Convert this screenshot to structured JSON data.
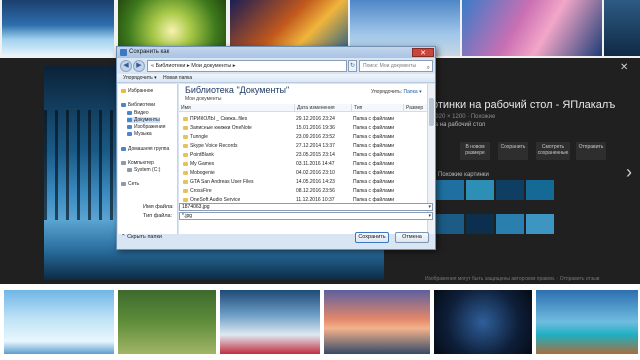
{
  "dialog": {
    "title": "Сохранить как",
    "close_label": "✕",
    "address": "« Библиотеки ▸ Мои документы ▸",
    "search_placeholder": "Поиск: Мои документы",
    "toolbar": {
      "organize": "Упорядочить ▾",
      "new_folder": "Новая папка"
    },
    "nav_pane": {
      "favorites": "Избранное",
      "downloads": "Видео",
      "documents": "Документы",
      "images": "Изображения",
      "music": "Музыка",
      "libraries_label": "Библиотеки",
      "homegroup": "Домашняя группа",
      "computer": "Компьютер",
      "system_c": "System (C:)",
      "network": "Сеть"
    },
    "library": {
      "title": "Библиотека \"Документы\"",
      "subtitle": "Мои документы",
      "arrange_label": "Упорядочить:",
      "arrange_value": "Папка ▾"
    },
    "columns": [
      "Имя",
      "Дата изменения",
      "Тип",
      "Размер"
    ],
    "files": [
      {
        "name": "ПРИКОЛЫ _ Свежа..files",
        "date": "29.12.2016 23:24",
        "type": "Папка с файлами"
      },
      {
        "name": "Записные книжки OneNote",
        "date": "15.01.2016 19:36",
        "type": "Папка с файлами"
      },
      {
        "name": "Tunngle",
        "date": "23.09.2016 23:52",
        "type": "Папка с файлами"
      },
      {
        "name": "Skype Voice Records",
        "date": "27.12.2014 13:37",
        "type": "Папка с файлами"
      },
      {
        "name": "PointBlank",
        "date": "23.05.2015 23:14",
        "type": "Папка с файлами"
      },
      {
        "name": "My Games",
        "date": "03.11.2016 14:47",
        "type": "Папка с файлами"
      },
      {
        "name": "Mobogenie",
        "date": "04.02.2016 23:10",
        "type": "Папка с файлами"
      },
      {
        "name": "GTA San Andreas User Files",
        "date": "14.05.2016 14:23",
        "type": "Папка с файлами"
      },
      {
        "name": "CrossFire",
        "date": "08.12.2016 23:56",
        "type": "Папка с файлами"
      },
      {
        "name": "OneSoft Audio Service",
        "date": "11.12.2016 10:37",
        "type": "Папка с файлами"
      }
    ],
    "file_name_label": "Имя файла:",
    "file_name_value": "1874063.jpg",
    "file_type_label": "Тип файла:",
    "file_type_value": "*.jpg",
    "hide_folders": "⌃ Скрыть папки",
    "save_button": "Сохранить",
    "cancel_button": "Отмена"
  },
  "viewer": {
    "title": "ртинки на рабочий стол - ЯПлакалъ",
    "subtitle": "1920 × 1200 · Похожие",
    "category": "ка на рабочий стол",
    "actions": [
      "В новом размере",
      "Сохранить",
      "Смотреть сохраненные",
      "Отправить"
    ],
    "similar_label": "Похожие картинки",
    "attribution": "Изображения могут быть защищены авторским правом. · Отправить отзыв"
  }
}
